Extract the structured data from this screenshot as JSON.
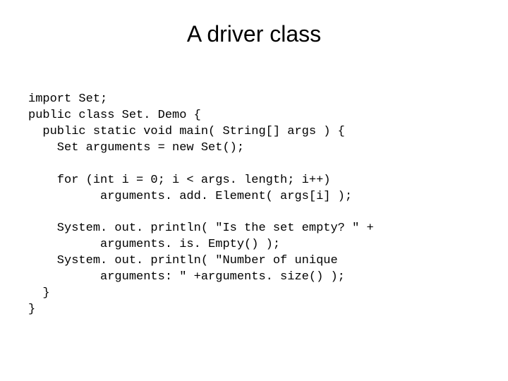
{
  "title": "A driver class",
  "code": {
    "line1": "import Set;",
    "line2": "public class Set. Demo {",
    "line3": "  public static void main( String[] args ) {",
    "line4": "    Set arguments = new Set();",
    "line5": "",
    "line6": "    for (int i = 0; i < args. length; i++)",
    "line7": "          arguments. add. Element( args[i] );",
    "line8": "",
    "line9": "    System. out. println( \"Is the set empty? \" +",
    "line10": "          arguments. is. Empty() );",
    "line11": "    System. out. println( \"Number of unique",
    "line12": "          arguments: \" +arguments. size() );",
    "line13": "  }",
    "line14": "}"
  }
}
